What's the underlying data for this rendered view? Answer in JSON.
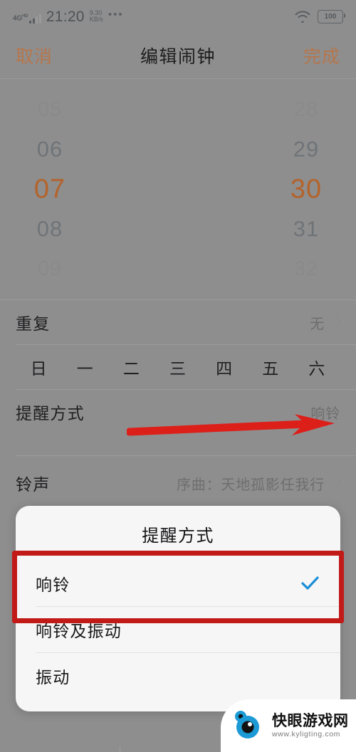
{
  "status_bar": {
    "network_type": "4G",
    "network_sup": "HD",
    "time": "21:20",
    "net_speed_value": "9.30",
    "net_speed_unit": "KB/s",
    "overflow_dots": "•••",
    "wifi_icon": "wifi-icon",
    "battery_level": "100"
  },
  "navbar": {
    "cancel_label": "取消",
    "title": "编辑闹钟",
    "done_label": "完成"
  },
  "time_picker": {
    "hours": [
      "05",
      "06",
      "07",
      "08",
      "09"
    ],
    "minutes": [
      "28",
      "29",
      "30",
      "31",
      "32"
    ],
    "selected_hour": "07",
    "selected_minute": "30",
    "accent_color": "#b4632b"
  },
  "rows": {
    "repeat": {
      "label": "重复",
      "value": "无"
    },
    "reminder_mode": {
      "label": "提醒方式",
      "value": "响铃"
    },
    "ringtone": {
      "label": "铃声",
      "value": "序曲：天地孤影任我行"
    }
  },
  "weekdays": [
    "日",
    "一",
    "二",
    "三",
    "四",
    "五",
    "六"
  ],
  "dialog": {
    "title": "提醒方式",
    "options": [
      {
        "label": "响铃",
        "checked": true
      },
      {
        "label": "响铃及振动",
        "checked": false
      },
      {
        "label": "振动",
        "checked": false
      }
    ],
    "check_color": "#1a8fd8",
    "highlight_color": "#c11a17"
  },
  "annotation": {
    "arrow_color": "#dd1f1a",
    "arrow_name": "red-pointer-arrow"
  },
  "watermark": {
    "site_name": "快眼游戏网",
    "url": "www.kyligting.com",
    "logo_color": "#1b9ad6"
  }
}
